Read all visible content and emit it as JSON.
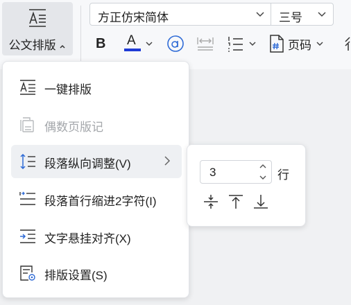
{
  "toolbar": {
    "doc_layout_label": "公文排版",
    "font_name": "方正仿宋简体",
    "font_size": "三号",
    "bold_label": "B",
    "font_color_label": "A",
    "page_number_label": "页码",
    "font_color_swatch": "#1f3bd6"
  },
  "menu": {
    "items": [
      {
        "label": "一键排版",
        "enabled": true
      },
      {
        "label": "偶数页版记",
        "enabled": false
      },
      {
        "label": "段落纵向调整(V)",
        "enabled": true,
        "has_submenu": true
      },
      {
        "label": "段落首行缩进2字符(I)",
        "enabled": true
      },
      {
        "label": "文字悬挂对齐(X)",
        "enabled": true
      },
      {
        "label": "排版设置(S)",
        "enabled": true
      }
    ]
  },
  "submenu": {
    "spin_value": "3",
    "unit": "行"
  },
  "colors": {
    "accent_blue": "#2f6bd6"
  }
}
